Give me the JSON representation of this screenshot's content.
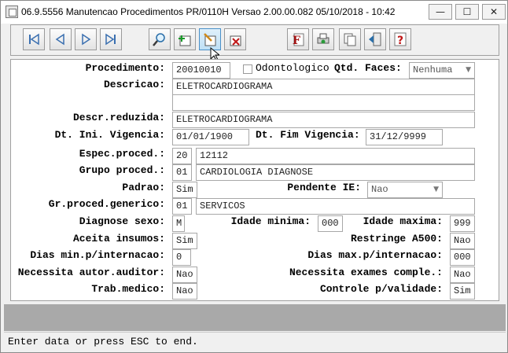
{
  "window": {
    "title": "06.9.5556 Manutencao  Procedimentos PR/0110H Versao 2.00.00.082 05/10/2018 - 10:42",
    "controls": {
      "minimize": "—",
      "maximize": "☐",
      "close": "✕"
    }
  },
  "toolbar": {
    "buttons": [
      {
        "name": "first-record-button",
        "icon": "first-icon"
      },
      {
        "name": "previous-record-button",
        "icon": "previous-icon"
      },
      {
        "name": "next-record-button",
        "icon": "next-icon"
      },
      {
        "name": "last-record-button",
        "icon": "last-icon"
      },
      {
        "name": "search-button",
        "icon": "search-icon"
      },
      {
        "name": "add-button",
        "icon": "add-icon"
      },
      {
        "name": "edit-button",
        "icon": "edit-icon"
      },
      {
        "name": "delete-button",
        "icon": "delete-icon"
      },
      {
        "name": "filter-button",
        "icon": "filter-icon"
      },
      {
        "name": "print-button",
        "icon": "print-icon"
      },
      {
        "name": "copy-button",
        "icon": "copy-icon"
      },
      {
        "name": "exit-button",
        "icon": "exit-icon"
      },
      {
        "name": "help-button",
        "icon": "help-icon"
      }
    ]
  },
  "form": {
    "procedimento": {
      "label": "Procedimento:",
      "value": "20010010"
    },
    "odontologico": {
      "label": "Odontologico",
      "checked": false
    },
    "qtd_faces": {
      "label": "Qtd. Faces:",
      "value": "Nenhuma"
    },
    "descricao": {
      "label": "Descricao:",
      "value": "ELETROCARDIOGRAMA",
      "value2": ""
    },
    "descr_reduzida": {
      "label": "Descr.reduzida:",
      "value": "ELETROCARDIOGRAMA"
    },
    "dt_ini": {
      "label": "Dt. Ini. Vigencia:",
      "value": "01/01/1900"
    },
    "dt_fim": {
      "label": "Dt. Fim Vigencia:",
      "value": "31/12/9999"
    },
    "espec_proced": {
      "label": "Espec.proced.:",
      "code": "20",
      "desc": "12112"
    },
    "grupo_proced": {
      "label": "Grupo proced.:",
      "code": "01",
      "desc": "CARDIOLOGIA DIAGNOSE"
    },
    "padrao": {
      "label": "Padrao:",
      "value": "Sim"
    },
    "pendente_ie": {
      "label": "Pendente IE:",
      "value": "Nao"
    },
    "gr_proced_generico": {
      "label": "Gr.proced.generico:",
      "code": "01",
      "desc": "SERVICOS"
    },
    "diagnose_sexo": {
      "label": "Diagnose sexo:",
      "value": "M"
    },
    "idade_minima": {
      "label": "Idade minima:",
      "value": "000"
    },
    "idade_maxima": {
      "label": "Idade maxima:",
      "value": "999"
    },
    "aceita_insumos": {
      "label": "Aceita insumos:",
      "value": "Sim"
    },
    "restringe_a500": {
      "label": "Restringe A500:",
      "value": "Nao"
    },
    "dias_min": {
      "label": "Dias min.p/internacao:",
      "value": "0"
    },
    "dias_max": {
      "label": "Dias max.p/internacao:",
      "value": "000"
    },
    "necessita_autor": {
      "label": "Necessita autor.auditor:",
      "value": "Nao"
    },
    "necessita_exames": {
      "label": "Necessita exames comple.:",
      "value": "Nao"
    },
    "trab_medico": {
      "label": "Trab.medico:",
      "value": "Nao"
    },
    "controle_validade": {
      "label": "Controle p/validade:",
      "value": "Sim"
    }
  },
  "status": {
    "message": "Enter data or press ESC to end."
  }
}
